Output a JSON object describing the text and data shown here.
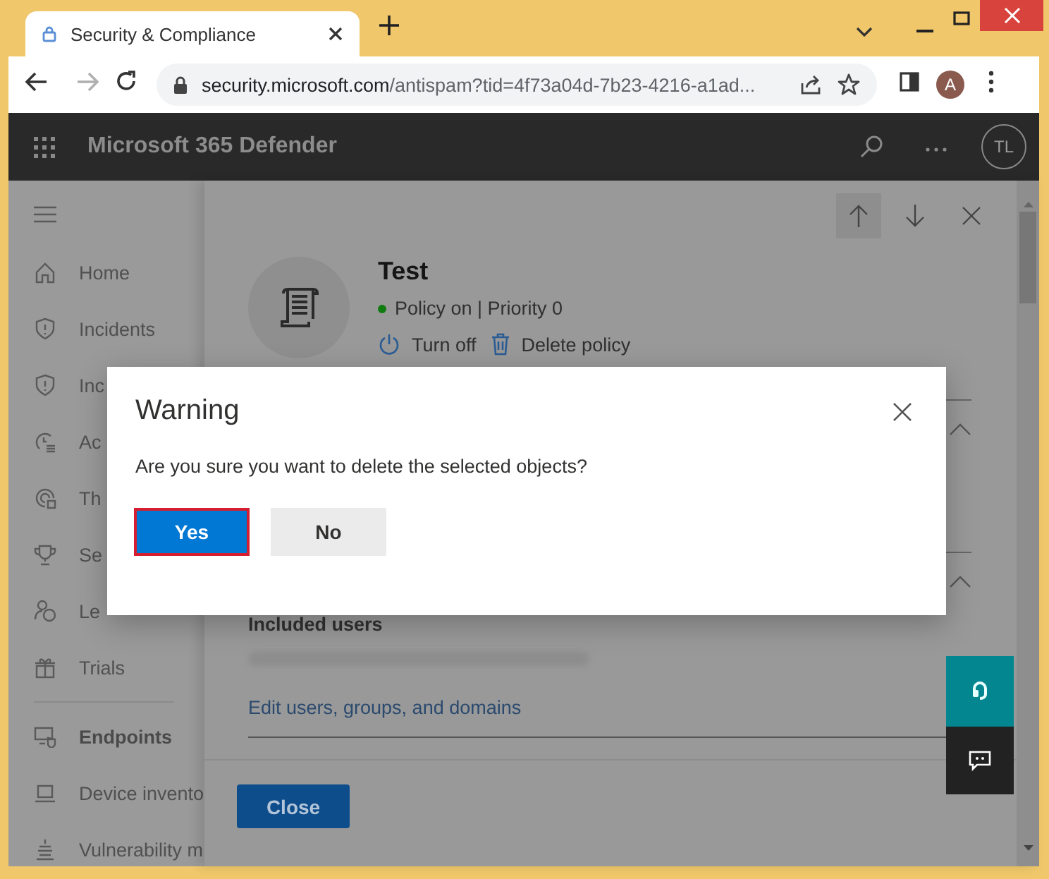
{
  "browser": {
    "tab_title": "Security & Compliance",
    "url_host": "security.microsoft.com",
    "url_rest": "/antispam?tid=4f73a04d-7b23-4216-a1ad...",
    "forward_disabled": true,
    "profile_initial": "A"
  },
  "app": {
    "title": "Microsoft 365 Defender",
    "user_initials": "TL"
  },
  "sidebar": {
    "items": [
      {
        "label": "Home",
        "kind": "item"
      },
      {
        "label": "Incidents",
        "kind": "item"
      },
      {
        "label": "Inc",
        "kind": "item"
      },
      {
        "label": "Ac",
        "kind": "item"
      },
      {
        "label": "Th",
        "kind": "item"
      },
      {
        "label": "Se",
        "kind": "item"
      },
      {
        "label": "Le",
        "kind": "item"
      },
      {
        "label": "Trials",
        "kind": "item"
      },
      {
        "label": "Endpoints",
        "kind": "section"
      },
      {
        "label": "Device invento",
        "kind": "item"
      },
      {
        "label": "Vulnerability m",
        "kind": "item"
      }
    ]
  },
  "panel": {
    "title": "Test",
    "status": "Policy on | Priority 0",
    "status_on": true,
    "actions": [
      {
        "label": "Turn off",
        "kind": "power"
      },
      {
        "label": "Delete policy",
        "kind": "delete"
      }
    ],
    "section_label": "Included users",
    "link": "Edit users, groups, and domains",
    "close_button": "Close"
  },
  "dialog": {
    "title": "Warning",
    "message": "Are you sure you want to delete the selected objects?",
    "buttons": [
      {
        "label": "Yes",
        "kind": "primary",
        "focused": true
      },
      {
        "label": "No",
        "kind": "default",
        "focused": false
      }
    ]
  }
}
